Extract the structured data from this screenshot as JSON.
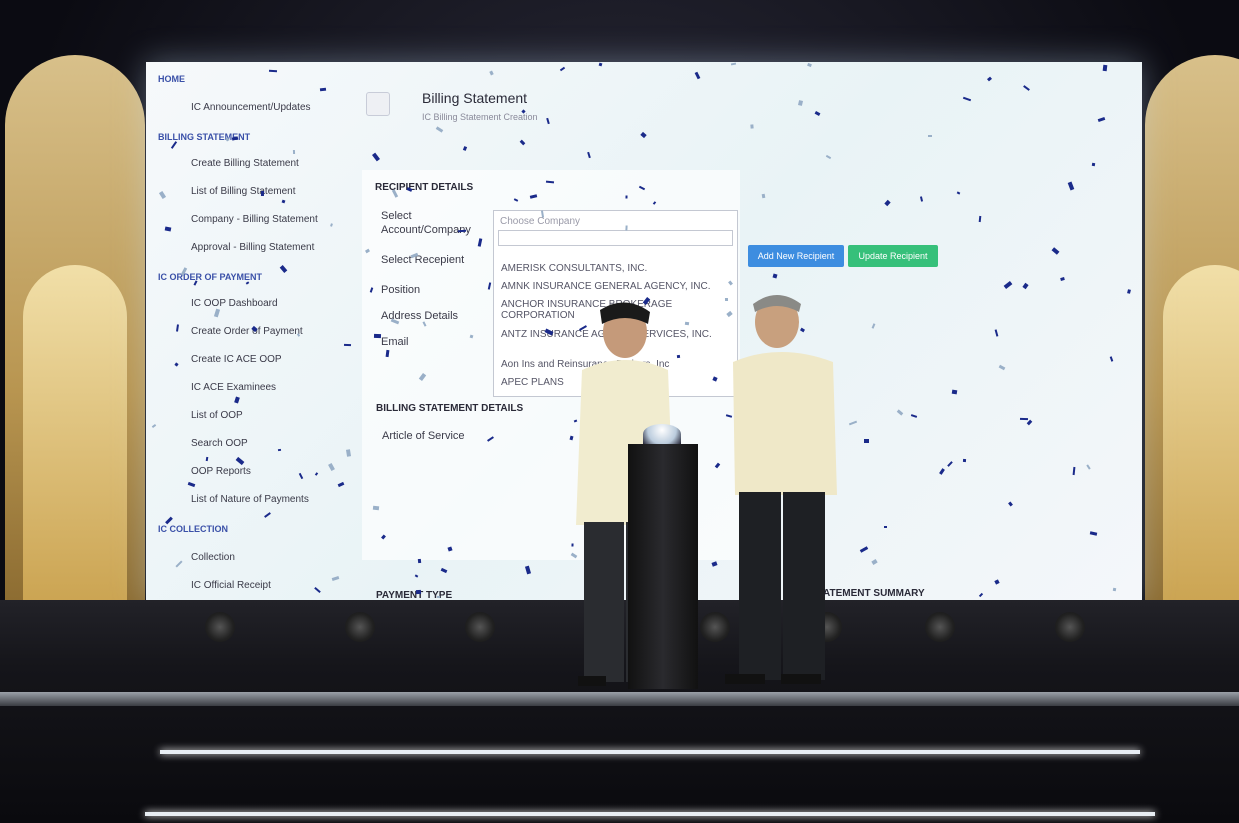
{
  "sidebar": {
    "sections": [
      {
        "title": "HOME",
        "items": [
          "IC Announcement/Updates"
        ]
      },
      {
        "title": "BILLING STATEMENT",
        "items": [
          "Create Billing Statement",
          "List of Billing Statement",
          "Company - Billing Statement",
          "Approval - Billing Statement"
        ]
      },
      {
        "title": "IC ORDER OF PAYMENT",
        "items": [
          "IC OOP Dashboard",
          "Create Order of Payment",
          "Create IC ACE OOP",
          "IC ACE Examinees",
          "List of OOP",
          "Search OOP",
          "OOP Reports",
          "List of Nature of Payments"
        ]
      },
      {
        "title": "IC COLLECTION",
        "items": [
          "Collection",
          "IC Official Receipt"
        ]
      }
    ]
  },
  "header": {
    "title": "Billing Statement",
    "subtitle": "IC Billing Statement Creation"
  },
  "recipient": {
    "heading": "RECIPIENT DETAILS",
    "labels": [
      "Select Account/Company",
      "Select Recepient",
      "Position",
      "Address Details",
      "Email"
    ]
  },
  "dropdown": {
    "placeholder": "Choose Company",
    "options": [
      "AMERISK CONSULTANTS, INC.",
      "AMNK INSURANCE GENERAL AGENCY, INC.",
      "ANCHOR INSURANCE BROKERAGE CORPORATION",
      "ANTZ INSURANCE AGENCY SERVICES, INC.",
      "Aon Ins and Reinsurance Brokers, Inc",
      "APEC PLANS"
    ]
  },
  "buttons": {
    "add": "Add New Recipient",
    "update": "Update Recipient"
  },
  "billing": {
    "heading": "BILLING STATEMENT DETAILS",
    "article_label": "Article of Service"
  },
  "payment": {
    "heading": "PAYMENT TYPE"
  },
  "summary": {
    "heading": "STATEMENT SUMMARY"
  },
  "colors": {
    "sidebar_section": "#3a50a8",
    "btn_blue": "#3d8de0",
    "btn_green": "#36c07a",
    "confetti": "#1a2a8a"
  }
}
